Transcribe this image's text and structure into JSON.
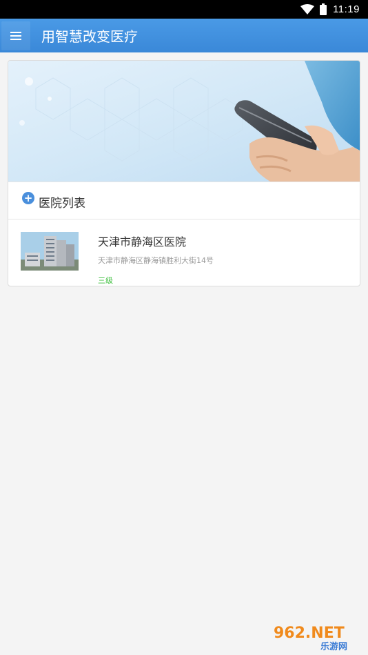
{
  "status_bar": {
    "time": "11:19",
    "wifi_icon": "wifi-icon",
    "battery_icon": "battery-icon"
  },
  "app_bar": {
    "title": "用智慧改变医疗",
    "menu_icon": "menu-icon"
  },
  "section": {
    "title": "医院列表",
    "icon": "plus-circle-icon"
  },
  "hospitals": [
    {
      "name": "天津市静海区医院",
      "address": "天津市静海区静海镇胜利大街14号",
      "level": "三级"
    }
  ],
  "watermark": {
    "brand": "962.NET",
    "sub": "乐游网"
  },
  "colors": {
    "app_bar": "#3f8fdf",
    "level": "#3fbf3f",
    "accent": "#4a8fdc"
  }
}
